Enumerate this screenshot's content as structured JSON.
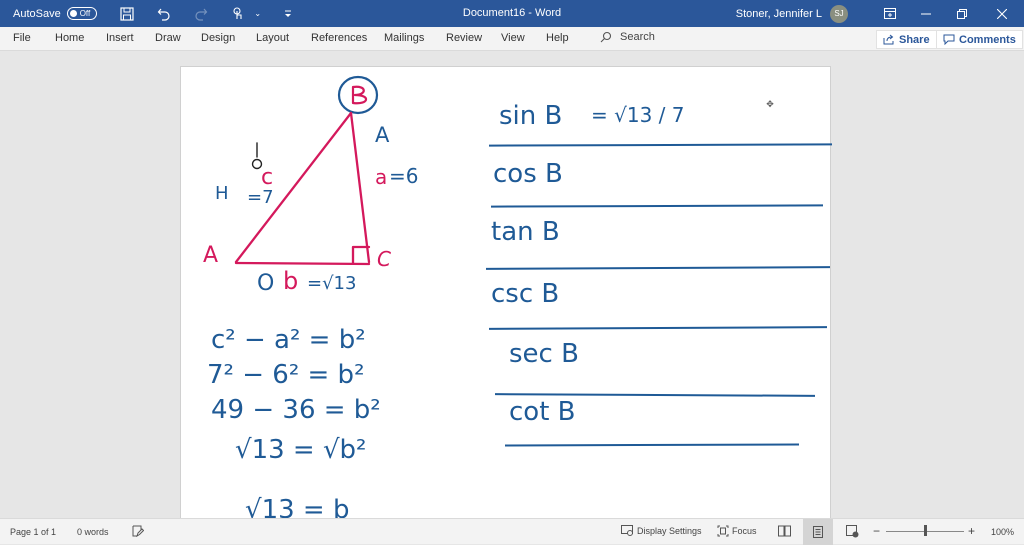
{
  "titlebar": {
    "autosave_label": "AutoSave",
    "autosave_state": "Off",
    "document_title": "Document16  -  Word",
    "user_name": "Stoner, Jennifer L",
    "user_initials": "SJ",
    "icons": [
      "save-icon",
      "undo-icon",
      "redo-icon",
      "touch-mode-icon",
      "customize-quick-access-icon"
    ]
  },
  "ribbon": {
    "tabs": [
      "File",
      "Home",
      "Insert",
      "Draw",
      "Design",
      "Layout",
      "References",
      "Mailings",
      "Review",
      "View",
      "Help"
    ],
    "search_label": "Search",
    "share_label": "Share",
    "comments_label": "Comments"
  },
  "document": {
    "ink_color_blue": "#1f5a96",
    "ink_color_pink": "#d4195c",
    "triangle": {
      "vertex_top": "B",
      "vertex_left": "A",
      "vertex_right": "C",
      "hyp_label": "H",
      "side_c_label": "c",
      "side_c_value": "=7",
      "side_a_label": "a",
      "side_a_value": "=6",
      "opp_label": "A",
      "adj_label": "O",
      "side_b_label": "b",
      "side_b_value": "=√13"
    },
    "work_lines": [
      "c² − a² = b²",
      "7² − 6² = b²",
      "49 − 36 = b²",
      "√13 = √b²",
      "√13 = b"
    ],
    "trig_rows": [
      {
        "label": "sin B",
        "value": "= √13 / 7"
      },
      {
        "label": "cos B",
        "value": ""
      },
      {
        "label": "tan B",
        "value": ""
      },
      {
        "label": "csc B",
        "value": ""
      },
      {
        "label": "sec B",
        "value": ""
      },
      {
        "label": "cot B",
        "value": ""
      }
    ]
  },
  "statusbar": {
    "page_info": "Page 1 of 1",
    "word_count": "0 words",
    "display_settings": "Display Settings",
    "focus": "Focus",
    "zoom_percent": "100%",
    "zoom_minus": "−",
    "zoom_plus": "+",
    "zoom_level": 1.0
  }
}
